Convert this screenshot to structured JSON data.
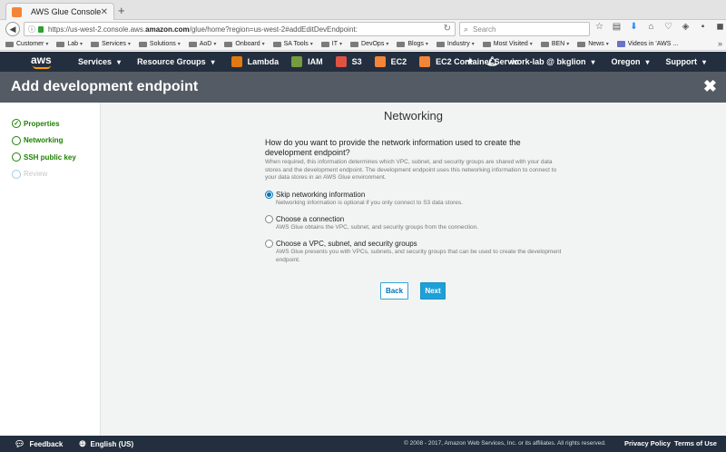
{
  "browser": {
    "tab_title": "AWS Glue Console",
    "tab_close": "✕",
    "new_tab": "+",
    "url_prefix": "https://us-west-2.console.aws.",
    "url_domain": "amazon.com",
    "url_suffix": "/glue/home?region=us-west-2#addEditDevEndpoint:",
    "search_placeholder": "Search",
    "bookmarks": [
      {
        "label": "Customer",
        "type": "folder"
      },
      {
        "label": "Lab",
        "type": "folder"
      },
      {
        "label": "Services",
        "type": "folder"
      },
      {
        "label": "Solutions",
        "type": "folder"
      },
      {
        "label": "AoD",
        "type": "folder"
      },
      {
        "label": "Onboard",
        "type": "folder"
      },
      {
        "label": "SA Tools",
        "type": "folder"
      },
      {
        "label": "IT",
        "type": "folder"
      },
      {
        "label": "DevOps",
        "type": "folder"
      },
      {
        "label": "Blogs",
        "type": "folder"
      },
      {
        "label": "Industry",
        "type": "folder"
      },
      {
        "label": "Most Visited",
        "type": "folder"
      },
      {
        "label": "BEN",
        "type": "folder"
      },
      {
        "label": "News",
        "type": "folder"
      },
      {
        "label": "Videos in 'AWS ...",
        "type": "video"
      }
    ]
  },
  "aws_header": {
    "logo": "aws",
    "services": "Services",
    "resource_groups": "Resource Groups",
    "shortcuts": [
      "Lambda",
      "IAM",
      "S3",
      "EC2",
      "EC2 Container Servic"
    ],
    "account": "work-lab @ bkglion",
    "region": "Oregon",
    "support": "Support"
  },
  "page": {
    "title": "Add development endpoint",
    "close": "✖"
  },
  "steps": [
    {
      "label": "Properties",
      "state": "done"
    },
    {
      "label": "Networking",
      "state": "current"
    },
    {
      "label": "SSH public key",
      "state": "current"
    },
    {
      "label": "Review",
      "state": "todo"
    }
  ],
  "main": {
    "heading": "Networking",
    "question": "How do you want to provide the network information used to create the development endpoint?",
    "description": "When required, this information determines which VPC, subnet, and security groups are shared with your data stores and the development endpoint. The development endpoint uses this networking information to connect to your data stores in an AWS Glue environment.",
    "options": [
      {
        "label": "Skip networking information",
        "sub": "Networking information is optional if you only connect to S3 data stores.",
        "selected": true
      },
      {
        "label": "Choose a connection",
        "sub": "AWS Glue obtains the VPC, subnet, and security groups from the connection.",
        "selected": false
      },
      {
        "label": "Choose a VPC, subnet, and security groups",
        "sub": "AWS Glue presents you with VPCs, subnets, and security groups that can be used to create the development endpoint.",
        "selected": false
      }
    ],
    "back_label": "Back",
    "next_label": "Next"
  },
  "footer": {
    "feedback": "Feedback",
    "language": "English (US)",
    "copyright": "© 2008 - 2017, Amazon Web Services, Inc. or its affiliates. All rights reserved.",
    "privacy": "Privacy Policy",
    "terms": "Terms of Use"
  },
  "colors": {
    "aws_nav": "#232f3e",
    "page_header": "#545b64",
    "step_green": "#1d8102",
    "next_button": "#1da0d8"
  }
}
